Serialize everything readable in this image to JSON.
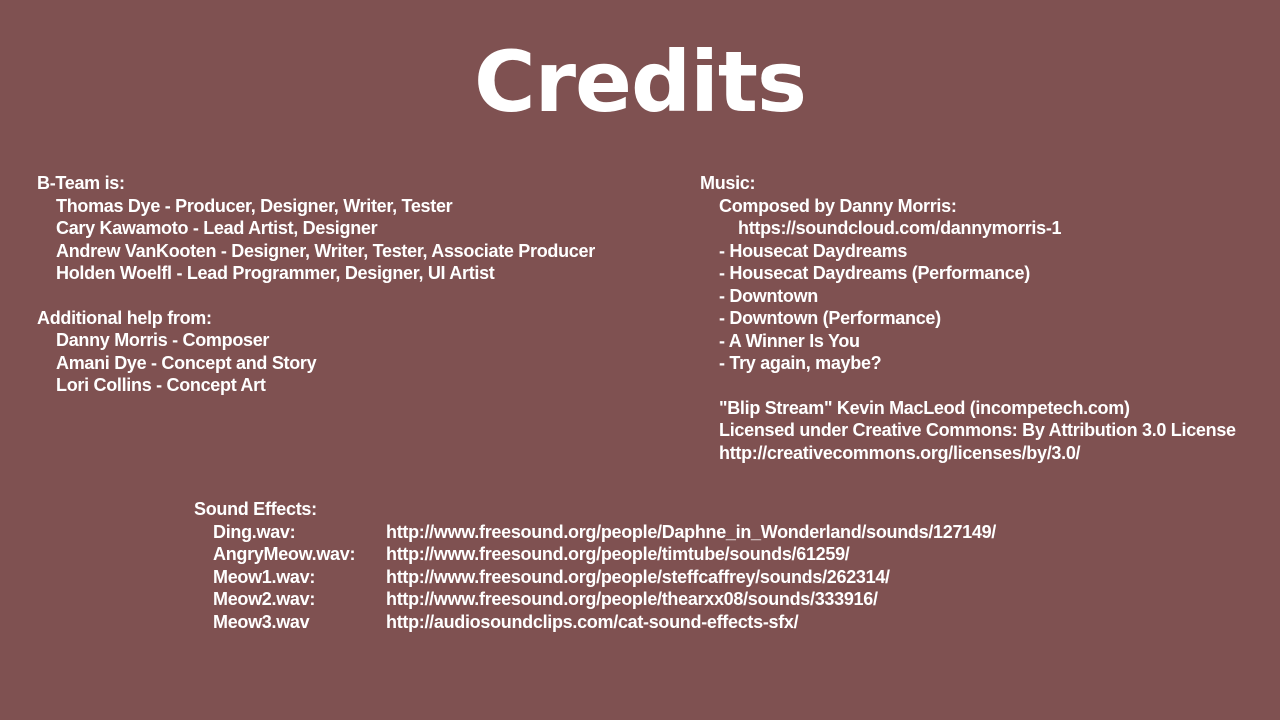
{
  "title": "Credits",
  "team": {
    "heading": "B-Team is:",
    "members": [
      "Thomas Dye - Producer, Designer, Writer, Tester",
      "Cary Kawamoto - Lead Artist, Designer",
      "Andrew VanKooten - Designer, Writer, Tester, Associate Producer",
      "Holden Woelfl - Lead Programmer, Designer, UI Artist"
    ]
  },
  "additional": {
    "heading": "Additional help from:",
    "members": [
      "Danny Morris - Composer",
      "Amani Dye - Concept and Story",
      "Lori Collins - Concept Art"
    ]
  },
  "music": {
    "heading": "Music:",
    "composer_line": "Composed by Danny Morris:",
    "composer_url": "https://soundcloud.com/dannymorris-1",
    "tracks": [
      "- Housecat Daydreams",
      "- Housecat Daydreams (Performance)",
      "- Downtown",
      "- Downtown (Performance)",
      "- A Winner Is You",
      "- Try again, maybe?"
    ],
    "extra": [
      "\"Blip Stream\" Kevin MacLeod (incompetech.com)",
      "Licensed under Creative Commons: By Attribution 3.0 License",
      "http://creativecommons.org/licenses/by/3.0/"
    ]
  },
  "sound_effects": {
    "heading": "Sound Effects:",
    "items": [
      {
        "file": "Ding.wav:",
        "url": "http://www.freesound.org/people/Daphne_in_Wonderland/sounds/127149/"
      },
      {
        "file": "AngryMeow.wav:",
        "url": "http://www.freesound.org/people/timtube/sounds/61259/"
      },
      {
        "file": "Meow1.wav:",
        "url": "http://www.freesound.org/people/steffcaffrey/sounds/262314/"
      },
      {
        "file": "Meow2.wav:",
        "url": "http://www.freesound.org/people/thearxx08/sounds/333916/"
      },
      {
        "file": "Meow3.wav",
        "url": "http://audiosoundclips.com/cat-sound-effects-sfx/"
      }
    ]
  },
  "colors": {
    "background": "#7f5151",
    "text": "#ffffff"
  }
}
